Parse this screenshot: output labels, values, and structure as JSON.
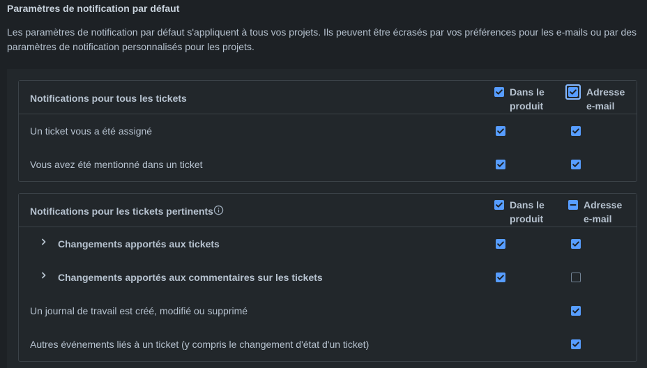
{
  "section": {
    "title": "Paramètres de notification par défaut",
    "description": "Les paramètres de notification par défaut s'appliquent à tous vos projets. Ils peuvent être écrasés par vos préférences pour les e-mails ou par des paramètres de notification personnalisés pour les projets."
  },
  "columns": {
    "product": "Dans le produit",
    "email": "Adresse e-mail"
  },
  "card1": {
    "title": "Notifications pour tous les tickets",
    "header_product": "checked",
    "header_email": "checked",
    "rows": [
      {
        "label": "Un ticket vous a été assigné",
        "product": "checked",
        "email": "checked"
      },
      {
        "label": "Vous avez été mentionné dans un ticket",
        "product": "checked",
        "email": "checked"
      }
    ]
  },
  "card2": {
    "title": "Notifications pour les tickets pertinents",
    "info_icon": "info-icon",
    "header_product": "checked",
    "header_email": "indeterminate",
    "rows": [
      {
        "label": "Changements apportés aux tickets",
        "expandable": true,
        "product": "checked",
        "email": "checked"
      },
      {
        "label": "Changements apportés aux commentaires sur les tickets",
        "expandable": true,
        "product": "checked",
        "email": "unchecked"
      },
      {
        "label": "Un journal de travail est créé, modifié ou supprimé",
        "expandable": false,
        "product": "none",
        "email": "checked"
      },
      {
        "label": "Autres événements liés à un ticket (y compris le changement d'état d'un ticket)",
        "expandable": false,
        "product": "none",
        "email": "checked"
      }
    ]
  },
  "colors": {
    "background": "#1d2125",
    "panel": "#22272b",
    "accent": "#579dff",
    "text": "#b6c2cf",
    "border": "#3b4248"
  }
}
